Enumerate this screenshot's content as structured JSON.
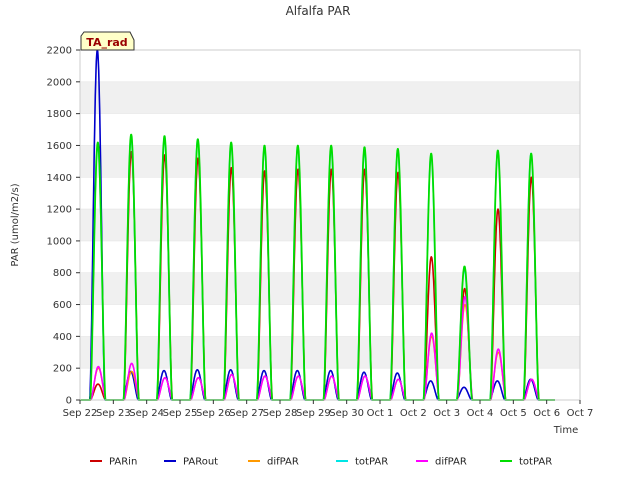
{
  "chart_data": {
    "type": "line",
    "title": "Alfalfa PAR",
    "xlabel": "Time",
    "ylabel": "PAR (umol/m2/s)",
    "ylim": [
      0,
      2200
    ],
    "yticks": [
      0,
      200,
      400,
      600,
      800,
      1000,
      1200,
      1400,
      1600,
      1800,
      2000,
      2200
    ],
    "xlim": [
      "Sep 22",
      "Oct 7"
    ],
    "xticks": [
      "Sep 22",
      "Sep 23",
      "Sep 24",
      "Sep 25",
      "Sep 26",
      "Sep 27",
      "Sep 28",
      "Sep 29",
      "Sep 30",
      "Oct 1",
      "Oct 2",
      "Oct 3",
      "Oct 4",
      "Oct 5",
      "Oct 6",
      "Oct 7"
    ],
    "grid": "horizontal alternating bands",
    "legend_position": "bottom",
    "annotation": "TA_rad",
    "series": [
      {
        "name": "PARin",
        "color": "#cc0000",
        "daily_peaks": [
          100,
          1560,
          1540,
          1520,
          1460,
          1440,
          1450,
          1450,
          1450,
          1430,
          900,
          700,
          1200,
          1400
        ]
      },
      {
        "name": "PARout",
        "color": "#0000cc",
        "daily_peaks": [
          2200,
          180,
          185,
          190,
          190,
          185,
          185,
          185,
          175,
          170,
          120,
          80,
          120,
          130
        ]
      },
      {
        "name": "difPAR",
        "color": "#ff9900",
        "daily_peaks": [
          200,
          180,
          140,
          140,
          160,
          150,
          150,
          150,
          150,
          130,
          400,
          600,
          300,
          130
        ]
      },
      {
        "name": "totPAR",
        "color": "#00e5e5",
        "daily_peaks": [
          1600,
          1650,
          1650,
          1640,
          1610,
          1590,
          1590,
          1580,
          1570,
          1570,
          1540,
          820,
          1560,
          1550
        ]
      },
      {
        "name": "difPAR",
        "color": "#ff00ff",
        "daily_peaks": [
          210,
          230,
          140,
          140,
          160,
          150,
          150,
          150,
          150,
          130,
          420,
          650,
          320,
          130
        ]
      },
      {
        "name": "totPAR",
        "color": "#00dd00",
        "daily_peaks": [
          1620,
          1670,
          1660,
          1640,
          1620,
          1600,
          1600,
          1600,
          1590,
          1580,
          1550,
          840,
          1570,
          1550
        ]
      }
    ]
  }
}
